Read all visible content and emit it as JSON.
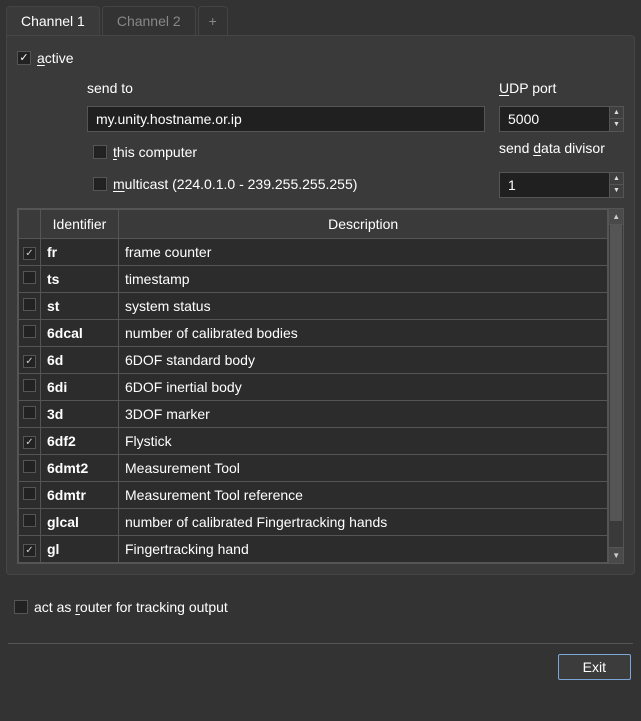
{
  "tabs": {
    "items": [
      {
        "label": "Channel 1",
        "active": true
      },
      {
        "label": "Channel 2",
        "active": false
      }
    ],
    "plus": "+"
  },
  "active": {
    "checked": true,
    "label_pre": "",
    "label_access": "a",
    "label_post": "ctive"
  },
  "send_to": {
    "label": "send to",
    "value": "my.unity.hostname.or.ip"
  },
  "udp_port": {
    "label_access": "U",
    "label_post": "DP port",
    "value": "5000"
  },
  "this_computer": {
    "checked": false,
    "label_access": "t",
    "label_post": "his computer"
  },
  "data_divisor": {
    "label_pre": "send ",
    "label_access": "d",
    "label_post": "ata divisor",
    "value": "1"
  },
  "multicast": {
    "checked": false,
    "label_access": "m",
    "label_post": "ulticast (224.0.1.0 - 239.255.255.255)"
  },
  "table": {
    "headers": {
      "identifier": "Identifier",
      "description": "Description"
    },
    "rows": [
      {
        "checked": true,
        "id": "fr",
        "desc": "frame counter"
      },
      {
        "checked": false,
        "id": "ts",
        "desc": "timestamp"
      },
      {
        "checked": false,
        "id": "st",
        "desc": "system status"
      },
      {
        "checked": false,
        "id": "6dcal",
        "desc": "number of calibrated bodies"
      },
      {
        "checked": true,
        "id": "6d",
        "desc": "6DOF standard body"
      },
      {
        "checked": false,
        "id": "6di",
        "desc": "6DOF inertial body"
      },
      {
        "checked": false,
        "id": "3d",
        "desc": "3DOF marker"
      },
      {
        "checked": true,
        "id": "6df2",
        "desc": "Flystick"
      },
      {
        "checked": false,
        "id": "6dmt2",
        "desc": "Measurement Tool"
      },
      {
        "checked": false,
        "id": "6dmtr",
        "desc": "Measurement Tool reference"
      },
      {
        "checked": false,
        "id": "glcal",
        "desc": "number of calibrated Fingertracking hands"
      },
      {
        "checked": true,
        "id": "gl",
        "desc": "Fingertracking hand"
      }
    ]
  },
  "router": {
    "checked": false,
    "label_pre": "act as ",
    "label_access": "r",
    "label_post": "outer for tracking output"
  },
  "exit": {
    "label": "Exit"
  }
}
